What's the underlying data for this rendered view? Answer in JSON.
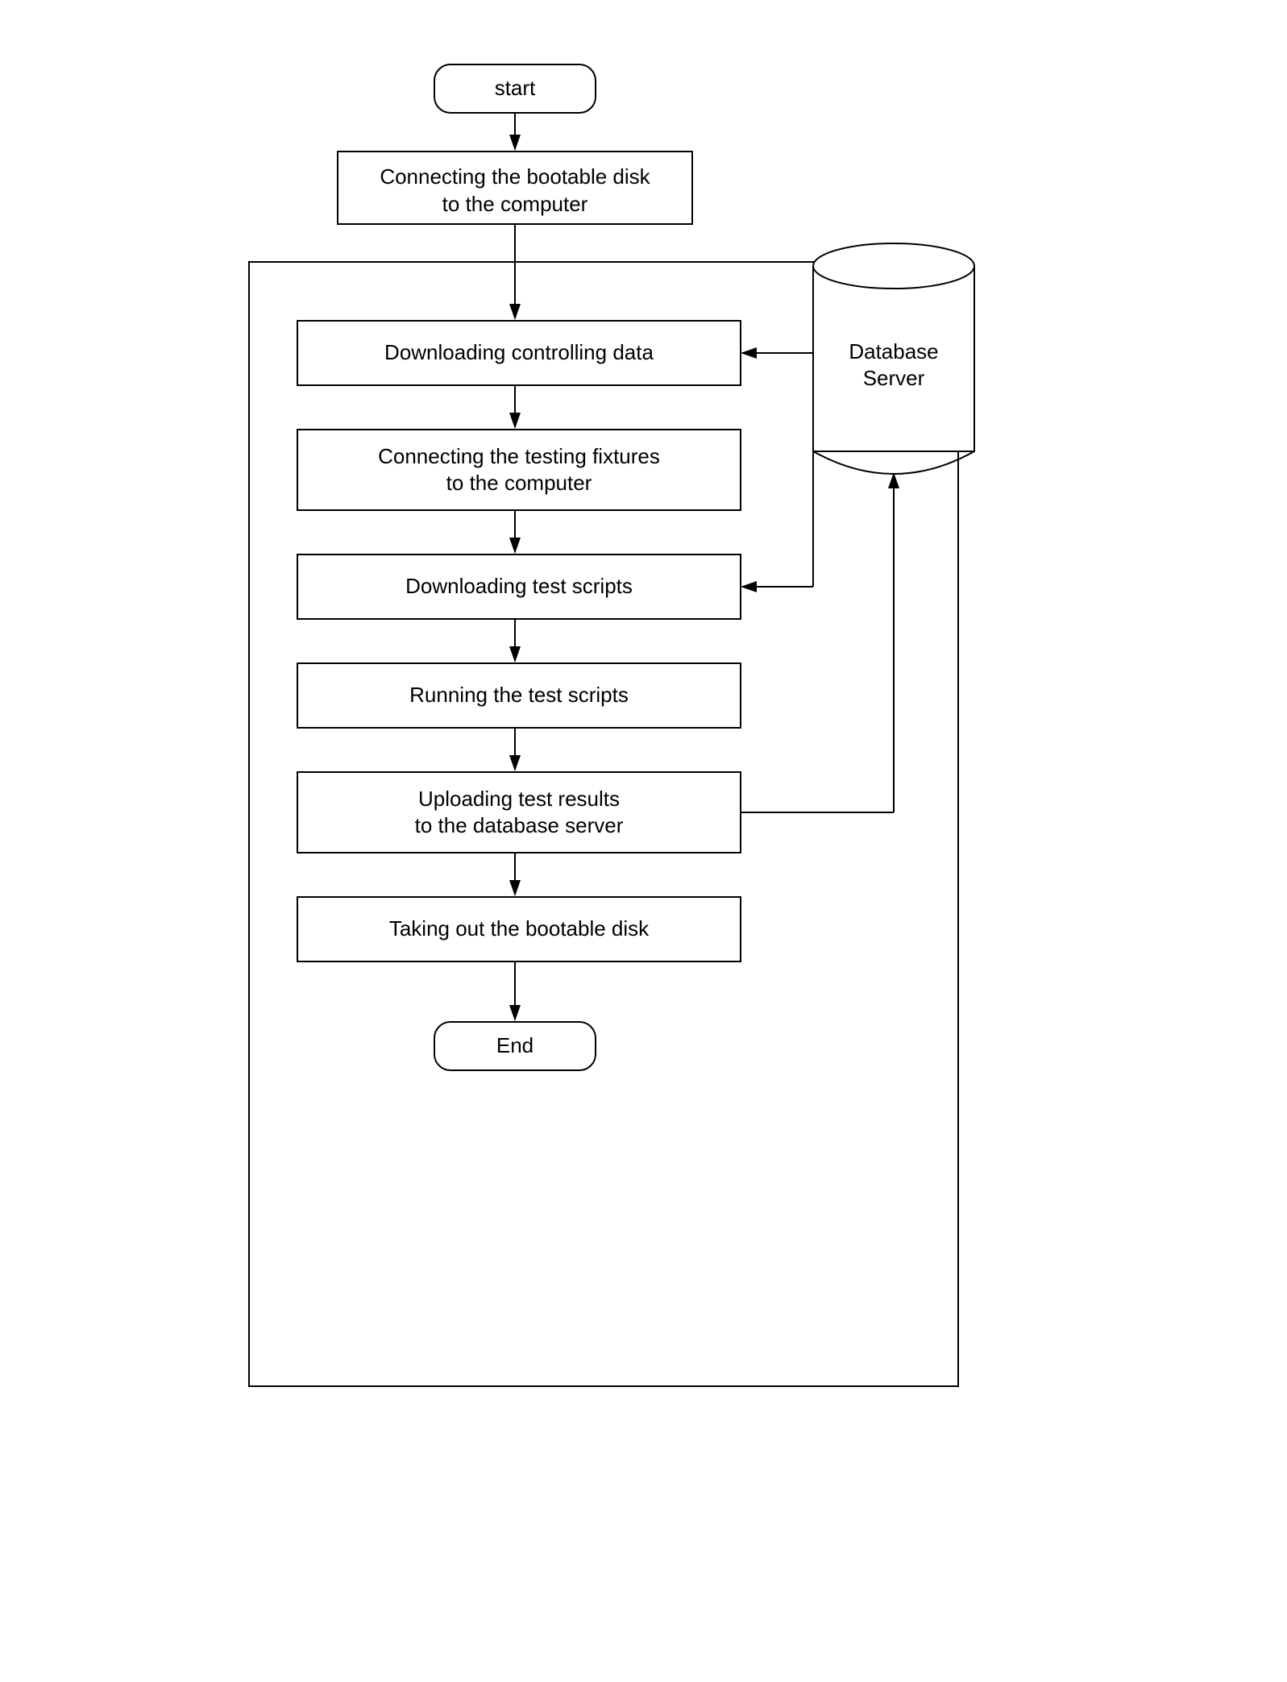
{
  "nodes": {
    "start": {
      "label": "start"
    },
    "bootable_disk": {
      "label": "Connecting the bootable disk\nto the computer"
    },
    "downloading_data": {
      "label": "Downloading controlling data"
    },
    "connecting_fixtures": {
      "label": "Connecting the testing fixtures\nto the computer"
    },
    "downloading_scripts": {
      "label": "Downloading test scripts"
    },
    "running_scripts": {
      "label": "Running the test scripts"
    },
    "uploading_results": {
      "label": "Uploading test results\nto the database server"
    },
    "taking_out_disk": {
      "label": "Taking out the bootable disk"
    },
    "end": {
      "label": "End"
    },
    "database_server": {
      "label": "Database\nServer"
    }
  }
}
